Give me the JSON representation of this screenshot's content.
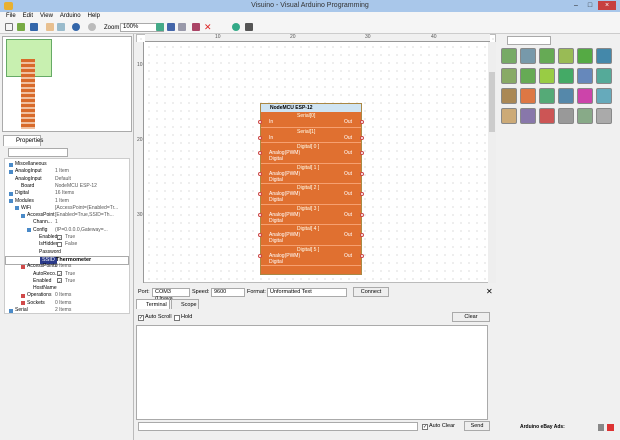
{
  "window": {
    "title": "Visuino - Visual Arduino Programming",
    "min": "–",
    "max": "□",
    "close": "×"
  },
  "menu": [
    "File",
    "Edit",
    "View",
    "Arduino",
    "Help"
  ],
  "toolbar": {
    "zoom_label": "Zoom:",
    "zoom_value": "100%"
  },
  "ruler": {
    "h": [
      "10",
      "20",
      "30",
      "40"
    ],
    "v": [
      "10",
      "20",
      "30"
    ]
  },
  "properties": {
    "tab": "Properties",
    "rows": [
      {
        "n": "Miscellaneous",
        "v": "",
        "d": 0,
        "ex": "b"
      },
      {
        "n": "AnalogInput",
        "v": "1 Item",
        "d": 0,
        "ex": "b"
      },
      {
        "n": "AnalogInput",
        "v": "Default",
        "d": 0,
        "ex": ""
      },
      {
        "n": "Board",
        "v": "NodeMCU ESP-12",
        "d": 1,
        "ex": "",
        "bold": true
      },
      {
        "n": "Digital",
        "v": "16 Items",
        "d": 0,
        "ex": "b"
      },
      {
        "n": "Modules",
        "v": "1 Item",
        "d": 0,
        "ex": "b"
      },
      {
        "n": "WiFi",
        "v": "[AccessPoint=(Enabled=Tr...",
        "d": 1,
        "ex": "b"
      },
      {
        "n": "AccessPoint",
        "v": "[Enabled=True,SSID=Th...",
        "d": 2,
        "ex": "b"
      },
      {
        "n": "Chann...",
        "v": "1",
        "d": 3,
        "ex": ""
      },
      {
        "n": "Config",
        "v": "(IP=0.0.0.0,Gateway=...",
        "d": 3,
        "ex": "b"
      },
      {
        "n": "Enabled",
        "v": "True",
        "d": 4,
        "ex": "",
        "cb": true
      },
      {
        "n": "IsHidden",
        "v": "False",
        "d": 4,
        "ex": "",
        "cb": false
      },
      {
        "n": "Password",
        "v": "",
        "d": 4,
        "ex": ""
      },
      {
        "n": "SSID",
        "v": "Thermometer",
        "d": 4,
        "ex": "",
        "sel": true
      },
      {
        "n": "AccessPoints",
        "v": "0 Items",
        "d": 2,
        "ex": "r"
      },
      {
        "n": "AutoReco...",
        "v": "True",
        "d": 3,
        "ex": "",
        "cb": true
      },
      {
        "n": "Enabled",
        "v": "True",
        "d": 3,
        "ex": "",
        "cb": true
      },
      {
        "n": "HostName",
        "v": "",
        "d": 3,
        "ex": ""
      },
      {
        "n": "Operations",
        "v": "0 Items",
        "d": 2,
        "ex": "r"
      },
      {
        "n": "Sockets",
        "v": "0 Items",
        "d": 2,
        "ex": "r"
      },
      {
        "n": "Serial",
        "v": "2 Items",
        "d": 0,
        "ex": "b"
      }
    ]
  },
  "component": {
    "title": "NodeMCU ESP-12",
    "sections": [
      {
        "t": "Serial[0]",
        "a": "In",
        "b": "",
        "o": "Out"
      },
      {
        "t": "Serial[1]",
        "a": "In",
        "b": "",
        "o": "Out"
      },
      {
        "t": "Digital[ 0 ]",
        "a": "Analog(PWM)",
        "b": "Digital",
        "o": "Out"
      },
      {
        "t": "Digital[ 1 ]",
        "a": "Analog(PWM)",
        "b": "Digital",
        "o": "Out"
      },
      {
        "t": "Digital[ 2 ]",
        "a": "Analog(PWM)",
        "b": "Digital",
        "o": "Out"
      },
      {
        "t": "Digital[ 3 ]",
        "a": "Analog(PWM)",
        "b": "Digital",
        "o": "Out"
      },
      {
        "t": "Digital[ 4 ]",
        "a": "Analog(PWM)",
        "b": "Digital",
        "o": "Out"
      },
      {
        "t": "Digital[ 5 ]",
        "a": "Analog(PWM)",
        "b": "Digital",
        "o": "Out"
      }
    ]
  },
  "serial": {
    "port_label": "Port:",
    "port": "COM3 (Unava",
    "speed_label": "Speed:",
    "speed": "9600",
    "format_label": "Format:",
    "format": "Unformatted Text",
    "connect": "Connect",
    "tabs": [
      "Terminal",
      "Scope"
    ],
    "auto_scroll": "Auto Scroll",
    "hold": "Hold",
    "clear": "Clear",
    "auto_clear": "Auto Clear",
    "send": "Send"
  },
  "ads": "Arduino eBay Ads:",
  "colors": {
    "component": "#e07030",
    "titlebar": "#a9c7ea",
    "selection": "#2a3a8a"
  }
}
